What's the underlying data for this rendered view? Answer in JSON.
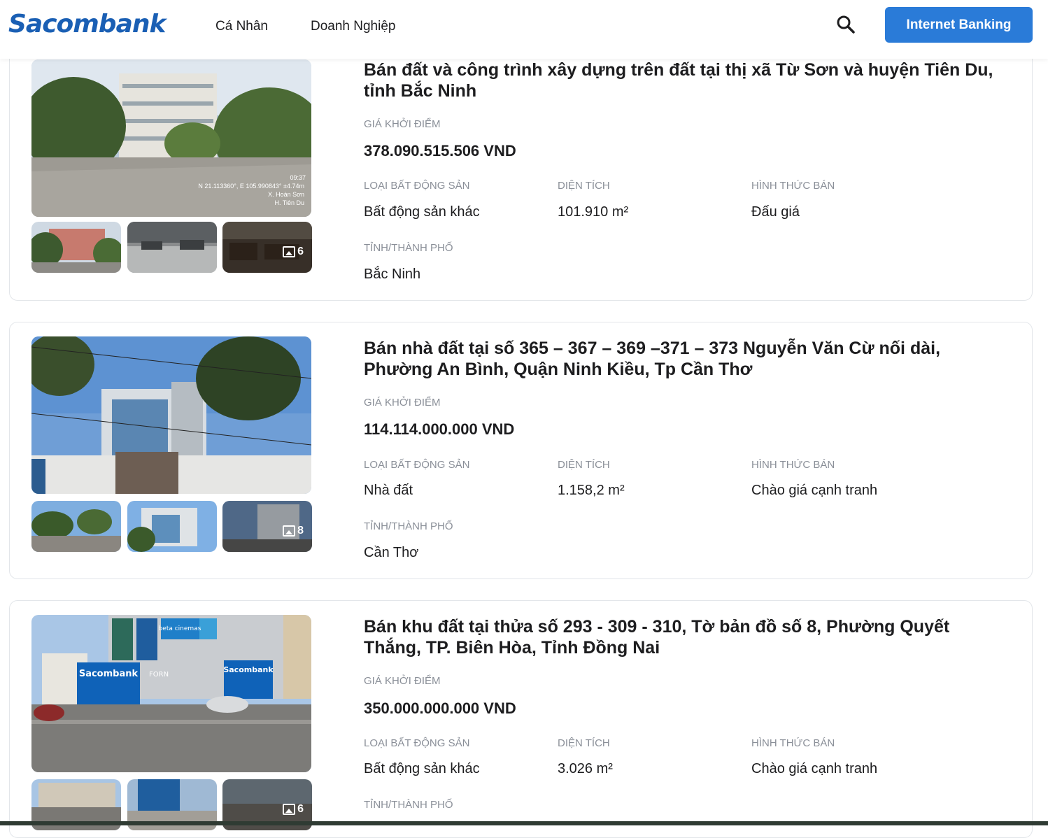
{
  "header": {
    "logo": "Sacombank",
    "nav": [
      "Cá Nhân",
      "Doanh Nghiệp"
    ],
    "search_icon": "search-icon",
    "internet_banking": "Internet Banking"
  },
  "listings": [
    {
      "title": "Bán đất và công trình xây dựng trên đất tại thị xã Từ Sơn và huyện Tiên Du, tỉnh Bắc Ninh",
      "price_label": "GIÁ KHỞI ĐIỂM",
      "price": "378.090.515.506 VND",
      "type_label": "LOẠI BẤT ĐỘNG SẢN",
      "type": "Bất động sản khác",
      "area_label": "DIỆN TÍCH",
      "area": "101.910 m²",
      "sale_label": "HÌNH THỨC BÁN",
      "sale": "Đấu giá",
      "province_label": "TỈNH/THÀNH PHỐ",
      "province": "Bắc Ninh",
      "more_photos": "6",
      "photo_overlay": {
        "time": "09:37",
        "coords": "N 21.113360°, E 105.990843° ±4.74m",
        "place1": "X. Hoàn Sơn",
        "place2": "H. Tiên Du"
      }
    },
    {
      "title": "Bán nhà đất tại số 365 – 367 – 369 –371 – 373 Nguyễn Văn Cừ nối dài, Phường An Bình, Quận Ninh Kiều, Tp Cần Thơ",
      "price_label": "GIÁ KHỞI ĐIỂM",
      "price": "114.114.000.000 VND",
      "type_label": "LOẠI BẤT ĐỘNG SẢN",
      "type": "Nhà đất",
      "area_label": "DIỆN TÍCH",
      "area": "1.158,2 m²",
      "sale_label": "HÌNH THỨC BÁN",
      "sale": "Chào giá cạnh tranh",
      "province_label": "TỈNH/THÀNH PHỐ",
      "province": "Cần Thơ",
      "more_photos": "8"
    },
    {
      "title": "Bán khu đất tại thửa số 293 - 309 - 310, Tờ bản đồ số 8, Phường Quyết Thắng, TP. Biên Hòa, Tỉnh Đồng Nai",
      "price_label": "GIÁ KHỞI ĐIỂM",
      "price": "350.000.000.000 VND",
      "type_label": "LOẠI BẤT ĐỘNG SẢN",
      "type": "Bất động sản khác",
      "area_label": "DIỆN TÍCH",
      "area": "3.026 m²",
      "sale_label": "HÌNH THỨC BÁN",
      "sale": "Chào giá cạnh tranh",
      "province_label": "TỈNH/THÀNH PHỐ",
      "more_photos": "6",
      "photo_signs": [
        "Sacombank",
        "Sacombank",
        "beta cinemas",
        "FORN"
      ]
    }
  ]
}
